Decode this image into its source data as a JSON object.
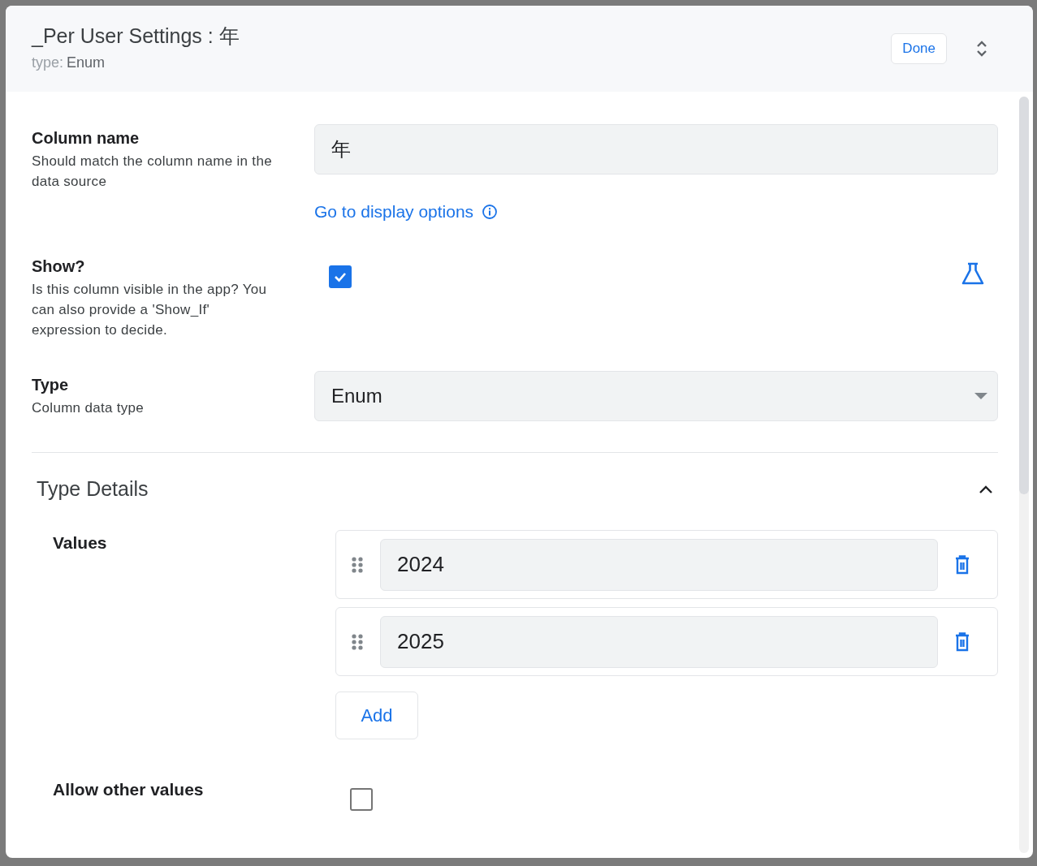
{
  "dialog": {
    "title": "_Per User Settings : 年",
    "type_label": "type:",
    "type_value": "Enum",
    "done_button": "Done"
  },
  "fields": [
    {
      "kind": "text",
      "label": "Column name",
      "description": "Should match the column name in the data source",
      "value": "年",
      "link": "Go to display options"
    },
    {
      "kind": "checkbox",
      "label": "Show?",
      "description": "Is this column visible in the app? You can also provide a 'Show_If' expression to decide.",
      "checked": true
    },
    {
      "kind": "select",
      "label": "Type",
      "description": "Column data type",
      "value": "Enum"
    }
  ],
  "type_details": {
    "title": "Type Details",
    "expanded": true,
    "values_label": "Values",
    "values": [
      {
        "value": "2024"
      },
      {
        "value": "2025"
      }
    ],
    "add_button": "Add",
    "allow_other": {
      "label": "Allow other values",
      "checked": false
    }
  }
}
